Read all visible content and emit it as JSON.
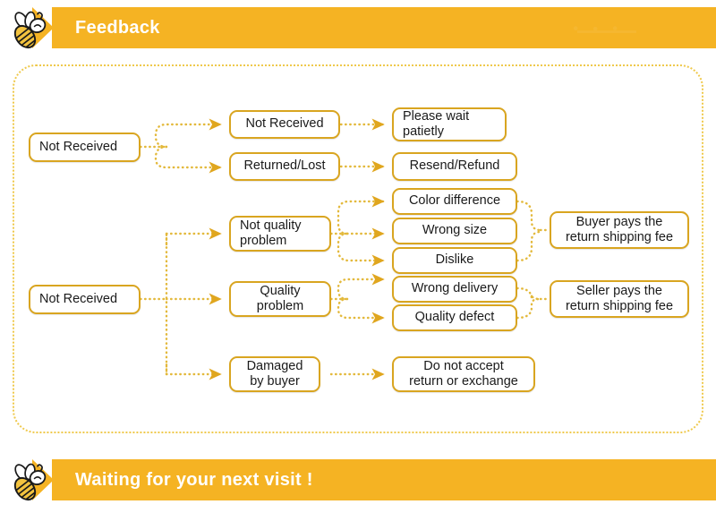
{
  "header": {
    "title": "Feedback",
    "bee_icon": "bee-icon",
    "accent_color": "#F5B323"
  },
  "footer": {
    "title": "Waiting for your next visit !",
    "bee_icon": "bee-icon",
    "accent_color": "#F5B323"
  },
  "theme": {
    "banner_background": "#F5B323",
    "banner_text": "#FFFFFF",
    "node_border": "#D9A520",
    "node_background": "#FFFFFF",
    "node_text": "#1A1A1A",
    "connector": "#E3B93C",
    "frame_border": "#EFC94C",
    "page_background": "#FFFFFF"
  },
  "flowchart": {
    "type": "flowchart",
    "branches": [
      {
        "id": "branch-not-received-top",
        "root": "Not Received",
        "children": [
          {
            "label": "Not Received",
            "outcome": "Please wait\npatietly"
          },
          {
            "label": "Returned/Lost",
            "outcome": "Resend/Refund"
          }
        ]
      },
      {
        "id": "branch-not-received-bottom",
        "root": "Not Received",
        "children": [
          {
            "label": "Not quality\nproblem",
            "reasons": [
              "Color difference",
              "Wrong size",
              "Dislike"
            ],
            "outcome": "Buyer pays the\nreturn shipping fee"
          },
          {
            "label": "Quality\nproblem",
            "reasons": [
              "Wrong delivery",
              "Quality defect"
            ],
            "outcome": "Seller pays the\nreturn shipping fee"
          },
          {
            "label": "Damaged\nby buyer",
            "reasons": [],
            "outcome": "Do not accept\nreturn or exchange"
          }
        ]
      }
    ],
    "nodes": {
      "root_top": "Not Received",
      "root_bottom": "Not Received",
      "mid_not_received": "Not Received",
      "mid_returned_lost": "Returned/Lost",
      "out_please_wait_l1": "Please wait",
      "out_please_wait_l2": "patietly",
      "out_resend_refund": "Resend/Refund",
      "mid_not_quality_l1": "Not quality",
      "mid_not_quality_l2": "problem",
      "mid_quality_l1": "Quality",
      "mid_quality_l2": "problem",
      "mid_damaged_l1": "Damaged",
      "mid_damaged_l2": "by buyer",
      "reason_color_difference": "Color difference",
      "reason_wrong_size": "Wrong size",
      "reason_dislike": "Dislike",
      "reason_wrong_delivery": "Wrong delivery",
      "reason_quality_defect": "Quality defect",
      "out_buyer_pays_l1": "Buyer pays the",
      "out_buyer_pays_l2": "return shipping fee",
      "out_seller_pays_l1": "Seller pays the",
      "out_seller_pays_l2": "return shipping fee",
      "out_no_return_l1": "Do not accept",
      "out_no_return_l2": "return or exchange"
    }
  }
}
